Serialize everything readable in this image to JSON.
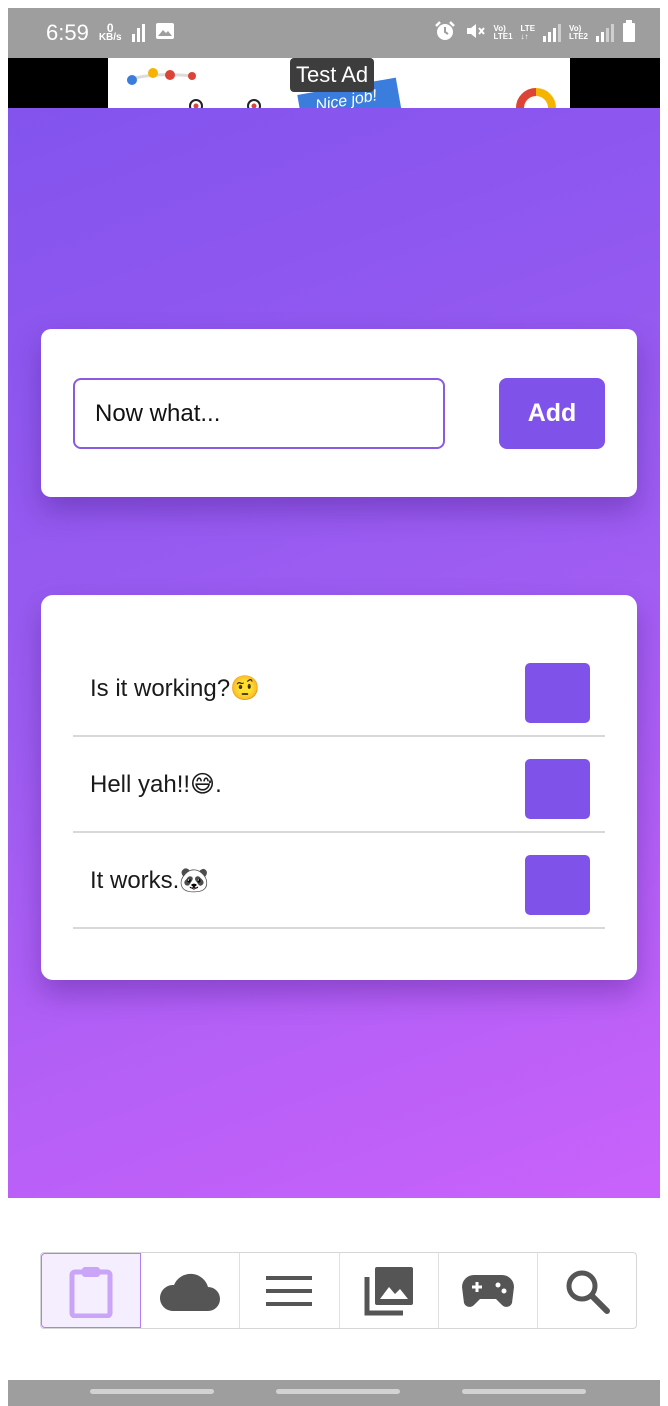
{
  "status_bar": {
    "time": "6:59",
    "net_speed_value": "0",
    "net_speed_unit": "KB/s",
    "sim1_label_top": "Vo)",
    "sim1_label_bottom": "LTE1",
    "lte_label": "LTE",
    "sim2_label_top": "Vo)",
    "sim2_label_bottom": "LTE2"
  },
  "ad": {
    "label": "Test Ad",
    "banner_text": "Nice job!"
  },
  "input": {
    "value": "Now what...",
    "add_label": "Add"
  },
  "todos": [
    {
      "text": "Is it working?🤨"
    },
    {
      "text": "Hell yah!!😅."
    },
    {
      "text": "It works.🐼"
    }
  ],
  "bottom_nav": {
    "tabs": [
      {
        "icon": "clipboard-icon",
        "active": true
      },
      {
        "icon": "cloud-icon",
        "active": false
      },
      {
        "icon": "menu-icon",
        "active": false
      },
      {
        "icon": "photo-library-icon",
        "active": false
      },
      {
        "icon": "gamepad-icon",
        "active": false
      },
      {
        "icon": "search-icon",
        "active": false
      }
    ]
  },
  "colors": {
    "accent": "#7f52ea",
    "gradient_start": "#8353ee",
    "gradient_end": "#c962fb",
    "nav_active_icon": "#c9a4f7",
    "nav_icon": "#555555"
  }
}
